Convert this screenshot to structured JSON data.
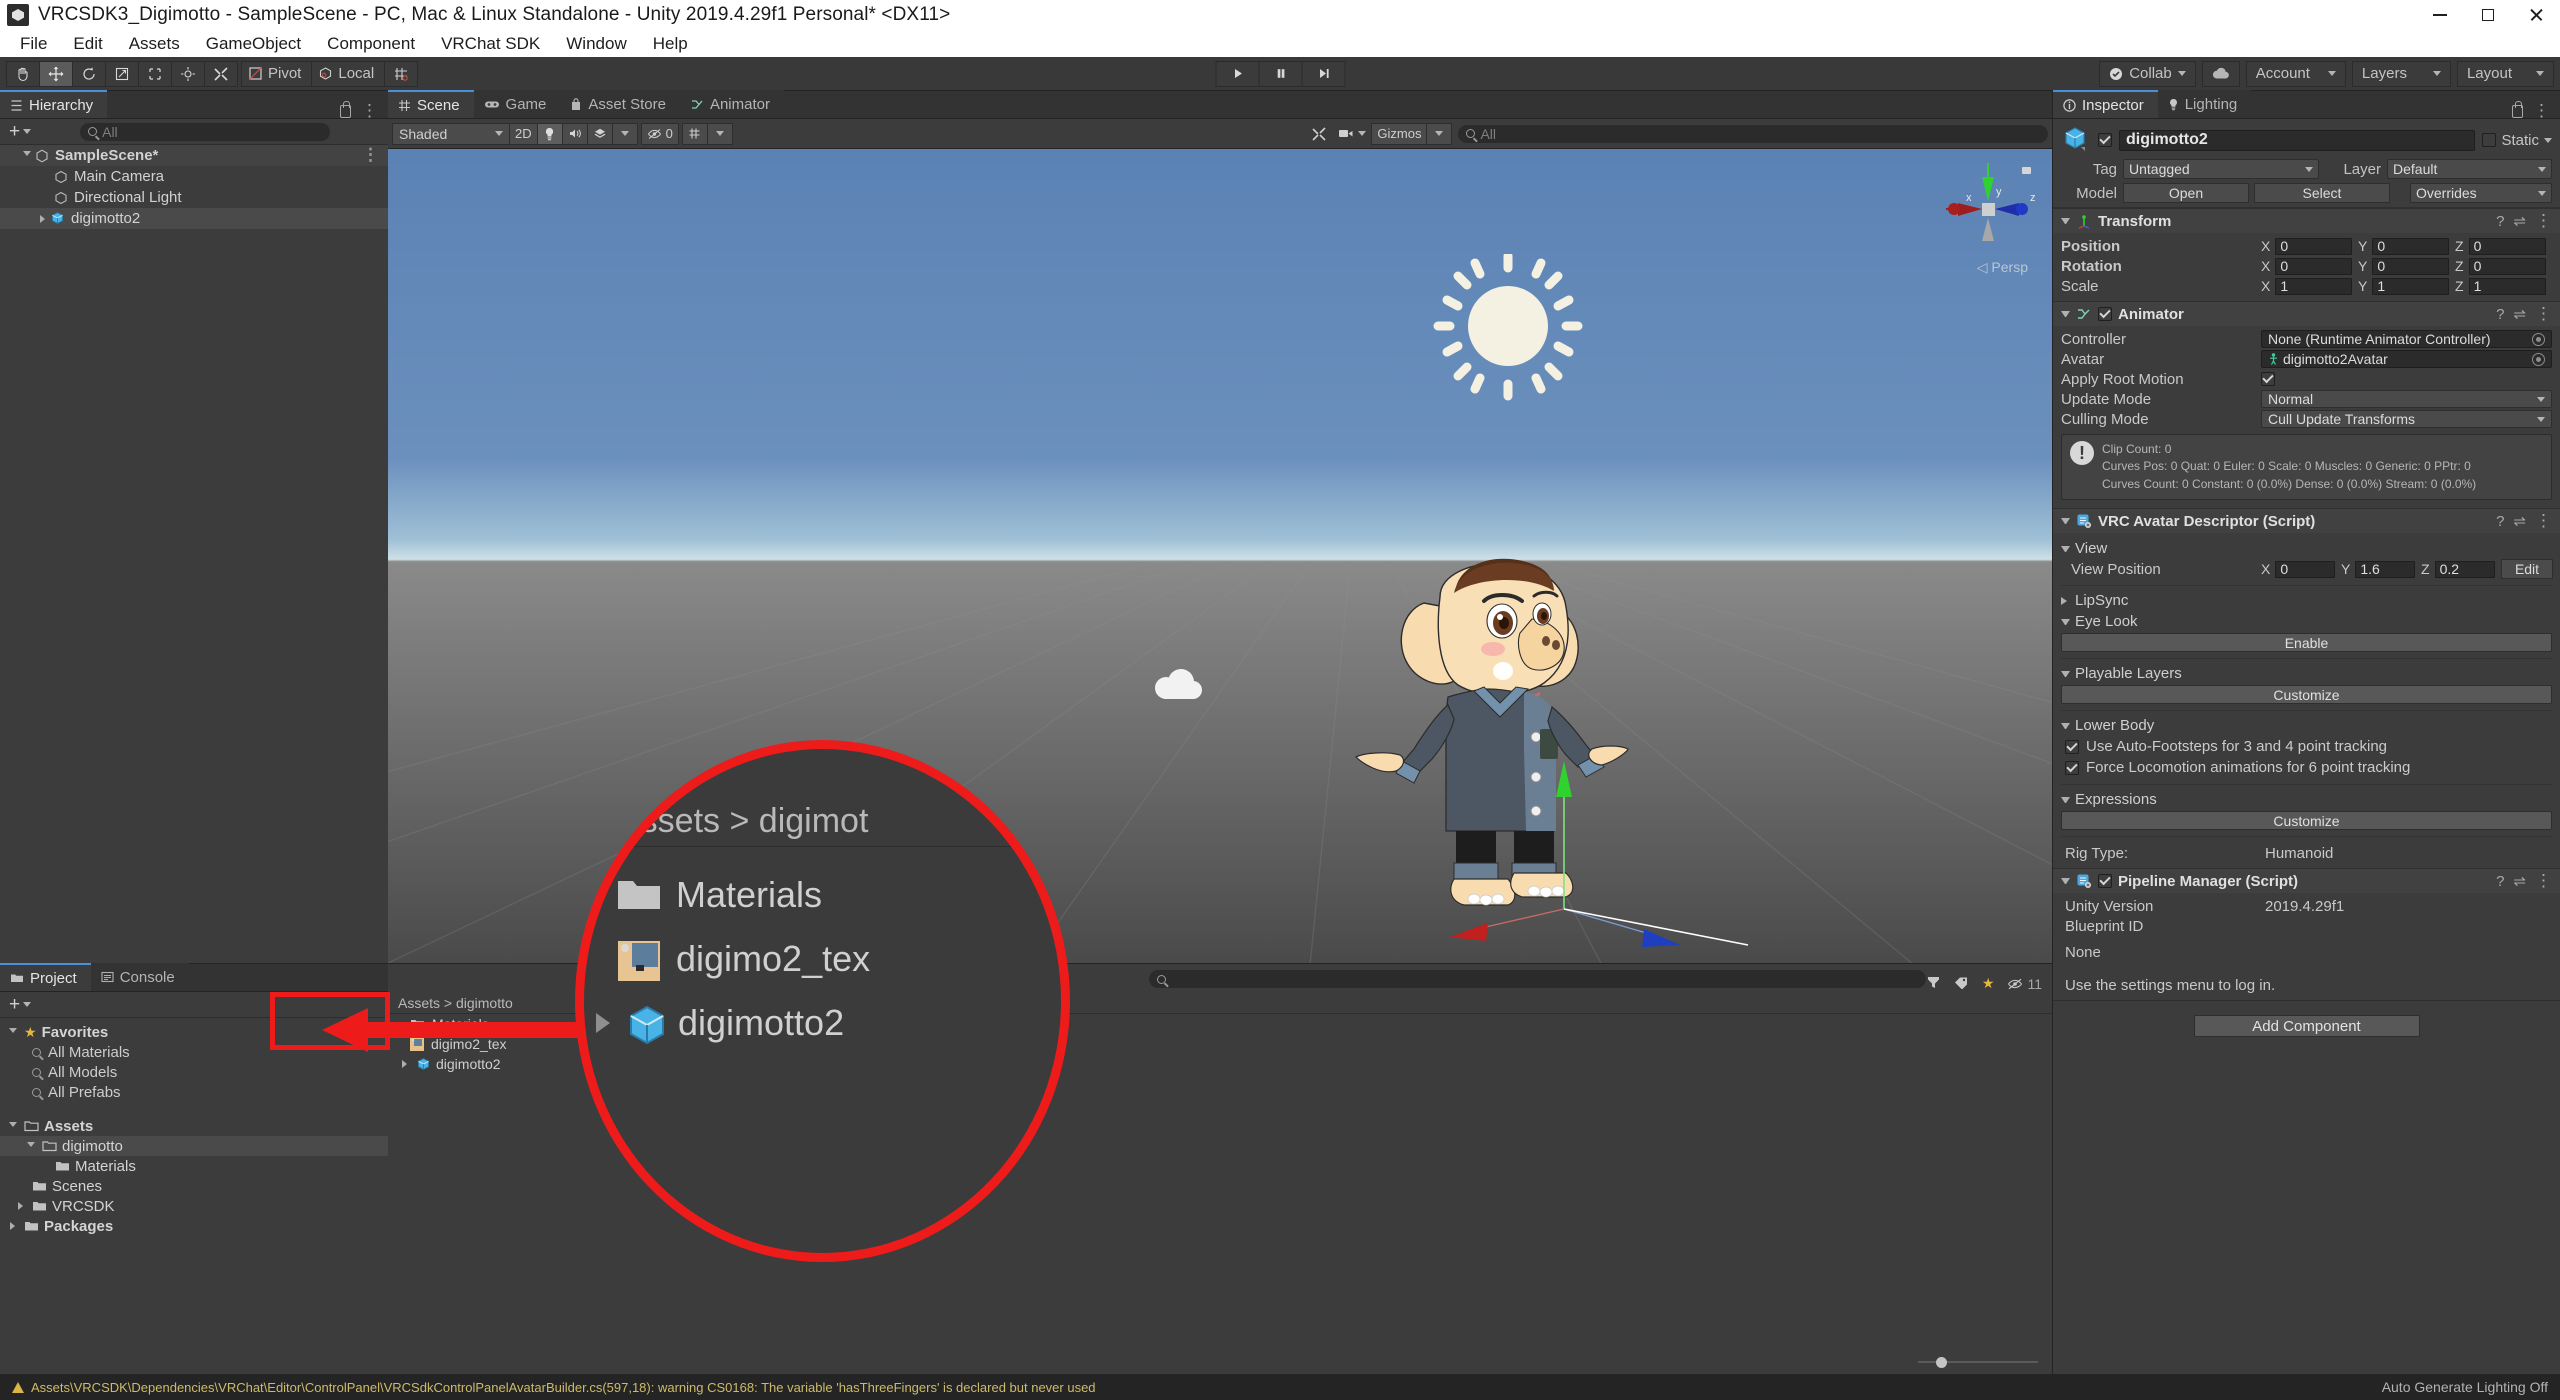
{
  "window": {
    "title": "VRCSDK3_Digimotto - SampleScene - PC, Mac & Linux Standalone - Unity 2019.4.29f1 Personal* <DX11>",
    "minimize": "–",
    "maximize": "□",
    "close": "✕"
  },
  "menubar": {
    "items": [
      "File",
      "Edit",
      "Assets",
      "GameObject",
      "Component",
      "VRChat SDK",
      "Window",
      "Help"
    ]
  },
  "toolbar": {
    "tools": [
      "hand-tool",
      "move-tool",
      "rotate-tool",
      "scale-tool",
      "rect-tool",
      "transform-tool",
      "custom-tool"
    ],
    "pivot_label": "Pivot",
    "local_label": "Local",
    "play": "▶",
    "pause": "❚❚",
    "step": "▶❙",
    "collab_label": "Collab",
    "cloud_label": "cloud-icon",
    "account_label": "Account",
    "layers_label": "Layers",
    "layout_label": "Layout"
  },
  "hierarchy": {
    "tab_label": "Hierarchy",
    "search_placeholder": "All",
    "add_label": "+",
    "items": [
      {
        "label": "SampleScene*",
        "depth": 0,
        "icon": "scene-icon",
        "expanded": true,
        "selected": false
      },
      {
        "label": "Main Camera",
        "depth": 1,
        "icon": "gameobject-icon",
        "expanded": false,
        "selected": false
      },
      {
        "label": "Directional Light",
        "depth": 1,
        "icon": "gameobject-icon",
        "expanded": false,
        "selected": false
      },
      {
        "label": "digimotto2",
        "depth": 1,
        "icon": "prefab-icon",
        "expanded": false,
        "selected": true
      }
    ]
  },
  "sceneview": {
    "tabs": [
      {
        "label": "Scene",
        "icon": "scene-grid-icon",
        "active": true
      },
      {
        "label": "Game",
        "icon": "game-icon",
        "active": false
      },
      {
        "label": "Asset Store",
        "icon": "store-icon",
        "active": false
      },
      {
        "label": "Animator",
        "icon": "animator-icon",
        "active": false
      }
    ],
    "shading_mode": "Shaded",
    "two_d_label": "2D",
    "lighting_toggle": "light-icon",
    "audio_toggle": "audio-icon",
    "fx_toggle": "fx-icon",
    "hidden_count": "0",
    "grid_label": "grid-icon",
    "gizmos_label": "Gizmos",
    "scene_search_placeholder": "All",
    "persp_label": "Persp",
    "gizmo_axes": [
      "x",
      "y",
      "z"
    ]
  },
  "project": {
    "tabs": [
      {
        "label": "Project",
        "icon": "folder-icon",
        "active": true
      },
      {
        "label": "Console",
        "icon": "console-icon",
        "active": false
      }
    ],
    "add_label": "+",
    "favorites_label": "Favorites",
    "favorites": [
      "All Materials",
      "All Models",
      "All Prefabs"
    ],
    "tree": [
      {
        "label": "Assets",
        "depth": 0,
        "expanded": true,
        "selected": false,
        "arrow": true
      },
      {
        "label": "digimotto",
        "depth": 1,
        "expanded": true,
        "selected": true,
        "arrow": true
      },
      {
        "label": "Materials",
        "depth": 2,
        "expanded": false,
        "selected": false,
        "arrow": false
      },
      {
        "label": "Scenes",
        "depth": 1,
        "expanded": false,
        "selected": false,
        "arrow": false
      },
      {
        "label": "VRCSDK",
        "depth": 1,
        "expanded": false,
        "selected": false,
        "arrow": true
      },
      {
        "label": "Packages",
        "depth": 0,
        "expanded": false,
        "selected": false,
        "arrow": true
      }
    ],
    "breadcrumb": "Assets  >  digimotto",
    "search_placeholder": "",
    "hidden_count": "11",
    "contents": [
      {
        "label": "Materials",
        "icon": "folder-icon",
        "arrow": false
      },
      {
        "label": "digimo2_tex",
        "icon": "texture-icon",
        "arrow": false
      },
      {
        "label": "digimotto2",
        "icon": "model-icon",
        "arrow": true
      }
    ]
  },
  "callout": {
    "breadcrumb": "Assets  >  digimot",
    "items": [
      {
        "label": "Materials",
        "icon": "folder-icon",
        "arrow": false
      },
      {
        "label": "digimo2_tex",
        "icon": "texture-icon",
        "arrow": false
      },
      {
        "label": "digimotto2",
        "icon": "model-icon",
        "arrow": true
      }
    ]
  },
  "inspector": {
    "tabs": [
      {
        "label": "Inspector",
        "icon": "info-icon",
        "active": true
      },
      {
        "label": "Lighting",
        "icon": "bulb-icon",
        "active": false
      }
    ],
    "object_name": "digimotto2",
    "enabled": true,
    "static_label": "Static",
    "tag_label": "Tag",
    "tag_value": "Untagged",
    "layer_label": "Layer",
    "layer_value": "Default",
    "model_label": "Model",
    "open_label": "Open",
    "select_label": "Select",
    "overrides_label": "Overrides",
    "transform": {
      "title": "Transform",
      "rows": [
        {
          "name": "Position",
          "x": "0",
          "y": "0",
          "z": "0"
        },
        {
          "name": "Rotation",
          "x": "0",
          "y": "0",
          "z": "0"
        },
        {
          "name": "Scale",
          "x": "1",
          "y": "1",
          "z": "1"
        }
      ],
      "axes": [
        "X",
        "Y",
        "Z"
      ]
    },
    "animator": {
      "title": "Animator",
      "enabled": true,
      "controller_label": "Controller",
      "controller_value": "None (Runtime Animator Controller)",
      "avatar_label": "Avatar",
      "avatar_value": "digimotto2Avatar",
      "apply_root_label": "Apply Root Motion",
      "apply_root_checked": true,
      "update_mode_label": "Update Mode",
      "update_mode_value": "Normal",
      "culling_mode_label": "Culling Mode",
      "culling_mode_value": "Cull Update Transforms",
      "info_lines": [
        "Clip Count: 0",
        "Curves Pos: 0 Quat: 0 Euler: 0 Scale: 0 Muscles: 0 Generic: 0 PPtr: 0",
        "Curves Count: 0 Constant: 0 (0.0%) Dense: 0 (0.0%) Stream: 0 (0.0%)"
      ]
    },
    "avatar_descriptor": {
      "title": "VRC Avatar Descriptor (Script)",
      "view_label": "View",
      "view_position_label": "View Position",
      "view_x": "0",
      "view_y": "1.6",
      "view_z": "0.2",
      "edit_label": "Edit",
      "lipsync_label": "LipSync",
      "eyelook_label": "Eye Look",
      "enable_label": "Enable",
      "playable_layers_label": "Playable Layers",
      "customize_label": "Customize",
      "lower_body_label": "Lower Body",
      "autofootsteps_label": "Use Auto-Footsteps for 3 and 4 point tracking",
      "autofootsteps_checked": true,
      "forcelocomotion_label": "Force Locomotion animations for 6 point tracking",
      "forcelocomotion_checked": true,
      "expressions_label": "Expressions",
      "expressions_customize_label": "Customize",
      "rig_type_label": "Rig Type:",
      "rig_type_value": "Humanoid"
    },
    "pipeline_manager": {
      "title": "Pipeline Manager (Script)",
      "enabled": true,
      "unity_version_label": "Unity Version",
      "unity_version_value": "2019.4.29f1",
      "blueprint_id_label": "Blueprint ID",
      "blueprint_id_value": "None",
      "login_hint": "Use the settings menu to log in."
    },
    "add_component_label": "Add Component"
  },
  "statusbar": {
    "message": "Assets\\VRCSDK\\Dependencies\\VRChat\\Editor\\ControlPanel\\VRCSdkControlPanelAvatarBuilder.cs(597,18): warning CS0168: The variable 'hasThreeFingers' is declared but never used",
    "right_message": "Auto Generate Lighting Off"
  },
  "colors": {
    "accent_blue": "#4a90d9",
    "callout_red": "#ee1b1b",
    "warning_yellow": "#cdbb6a",
    "panel_bg": "#3c3c3c",
    "axis_x": "#b02b2b",
    "axis_y": "#32c832",
    "axis_z": "#2a3fbf"
  }
}
